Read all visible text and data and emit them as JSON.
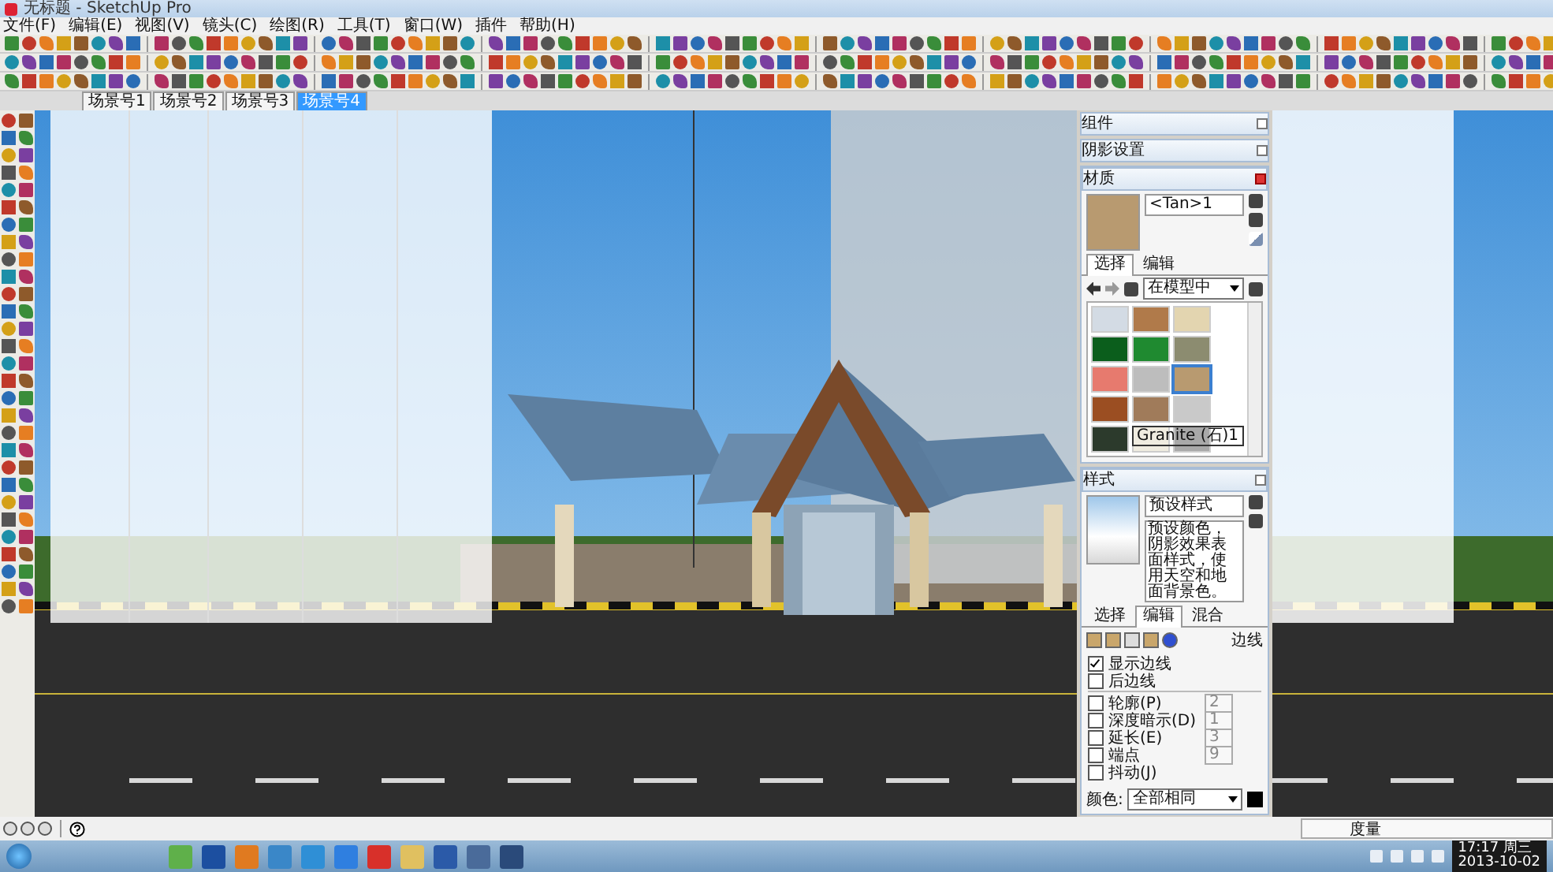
{
  "window": {
    "title": "无标题 - SketchUp Pro"
  },
  "menu": [
    "文件(F)",
    "编辑(E)",
    "视图(V)",
    "镜头(C)",
    "绘图(R)",
    "工具(T)",
    "窗口(W)",
    "插件",
    "帮助(H)"
  ],
  "scene_tabs": [
    {
      "label": "场景号1",
      "selected": false
    },
    {
      "label": "场景号2",
      "selected": false
    },
    {
      "label": "场景号3",
      "selected": false
    },
    {
      "label": "场景号4",
      "selected": true
    }
  ],
  "trays": [
    {
      "title": "组件"
    },
    {
      "title": "阴影设置"
    }
  ],
  "materials": {
    "title": "材质",
    "name": "<Tan>1",
    "tabs": [
      {
        "label": "选择",
        "selected": true
      },
      {
        "label": "编辑",
        "selected": false
      }
    ],
    "collection": "在模型中",
    "tooltip": "Granite (石)1",
    "swatches": [
      {
        "color": "#d3dbe4",
        "selected": false
      },
      {
        "color": "#b07a4a",
        "selected": false
      },
      {
        "color": "#e3d5b0",
        "selected": false
      },
      {
        "color": "#0b5e1c",
        "selected": false
      },
      {
        "color": "#1f8a30",
        "selected": false
      },
      {
        "color": "#8c8c70",
        "selected": false
      },
      {
        "color": "#e77a6e",
        "selected": false
      },
      {
        "color": "#bdbdbd",
        "selected": false
      },
      {
        "color": "#b89a70",
        "selected": true
      },
      {
        "color": "#9b4e22",
        "selected": false
      },
      {
        "color": "#a07b5a",
        "selected": false
      },
      {
        "color": "#c9c9c9",
        "selected": false
      },
      {
        "color": "#2c3a2c",
        "selected": false
      },
      {
        "color": "#f0ece0",
        "selected": false
      },
      {
        "color": "#a9a9a9",
        "selected": false
      }
    ]
  },
  "styles": {
    "title": "样式",
    "name": "预设样式",
    "description": "预设颜色，阴影效果表面样式，使用天空和地面背景色。",
    "tabs": [
      {
        "label": "选择",
        "selected": false
      },
      {
        "label": "编辑",
        "selected": true
      },
      {
        "label": "混合",
        "selected": false
      }
    ],
    "section": "边线",
    "options": [
      {
        "label": "显示边线",
        "checked": true
      },
      {
        "label": "后边线",
        "checked": false
      },
      {
        "label": "轮廓(P)",
        "checked": false,
        "value": "2"
      },
      {
        "label": "深度暗示(D)",
        "checked": false,
        "value": "1"
      },
      {
        "label": "延长(E)",
        "checked": false,
        "value": "3"
      },
      {
        "label": "端点",
        "checked": false,
        "value": "9"
      },
      {
        "label": "抖动(J)",
        "checked": false
      }
    ],
    "color_label": "颜色:",
    "color_mode": "全部相同"
  },
  "status_bar": {
    "measure_label": "度量"
  },
  "taskbar": {
    "time": "17:17 周三",
    "date": "2013-10-02"
  }
}
